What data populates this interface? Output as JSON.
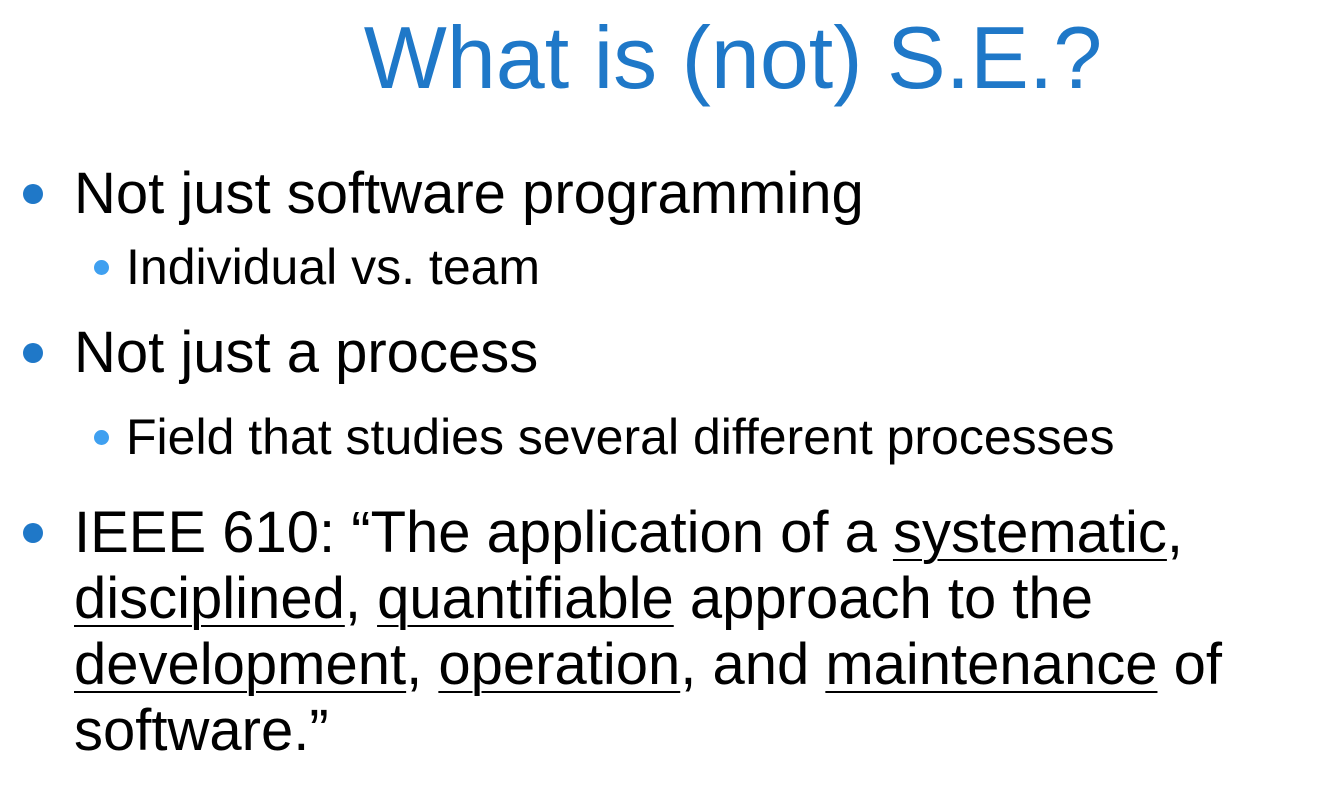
{
  "slide": {
    "title": "What is (not) S.E.?",
    "colors": {
      "title": "#1F78C8",
      "level1_bullet": "#1F78C8",
      "level2_bullet": "#3FA0F0",
      "text": "#000000"
    },
    "bullets": [
      {
        "text": "Not just software programming",
        "sub": [
          "Individual vs. team"
        ]
      },
      {
        "text": "Not just a process",
        "sub": [
          "Field that studies several different processes"
        ]
      }
    ],
    "quote": {
      "prefix": "IEEE 610: “The application of a ",
      "systematic": "systematic",
      "comma1": ",",
      "disciplined": "disciplined",
      "comma2": ", ",
      "quantifiable": "quantifiable",
      "mid1": " approach to the",
      "development": "development",
      "comma3": ", ",
      "operation": "operation",
      "mid2": ", and ",
      "maintenance": "maintenance",
      "mid3": " of",
      "end": "software.”"
    }
  }
}
